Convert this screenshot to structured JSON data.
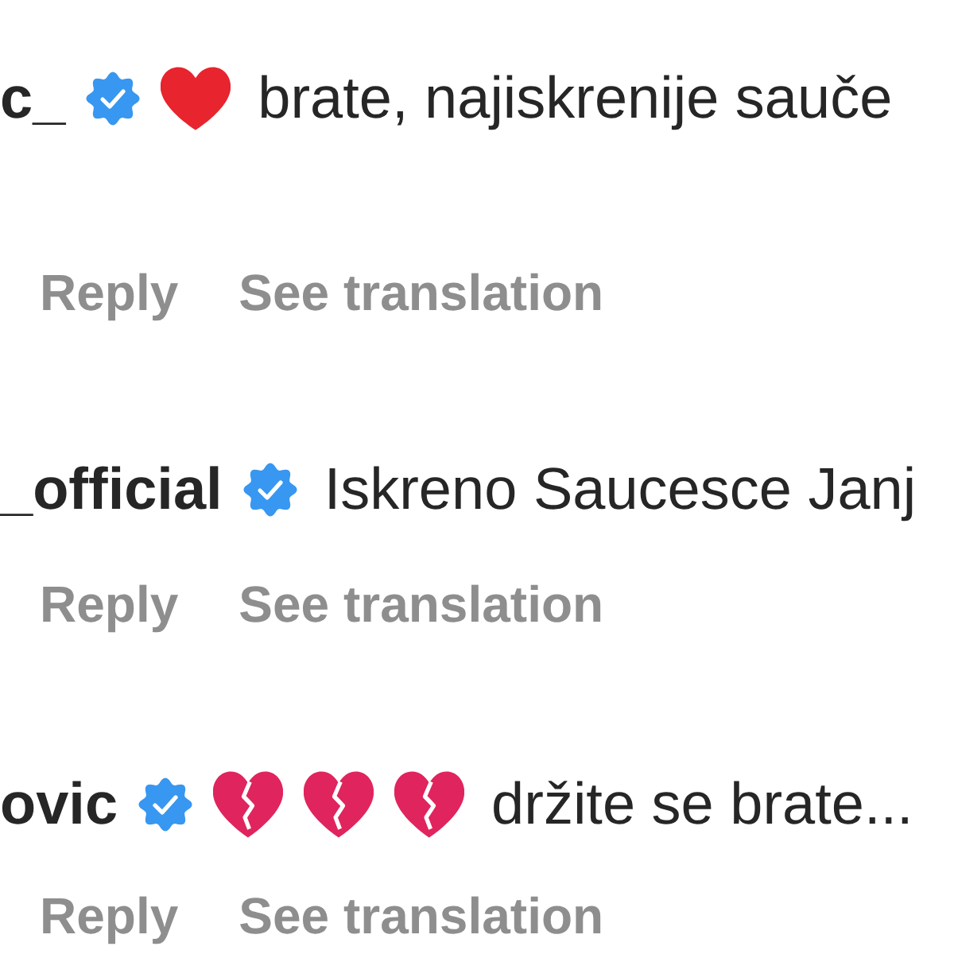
{
  "comments": [
    {
      "username": "c_",
      "verified": true,
      "emojis": [
        {
          "kind": "heart"
        }
      ],
      "text": "brate, najiskrenije sauče",
      "actions": [
        "Reply",
        "See translation"
      ]
    },
    {
      "username": "_official",
      "verified": true,
      "text": "Iskreno Saucesce Janj",
      "actions": [
        "Reply",
        "See translation"
      ]
    },
    {
      "username": "ovic",
      "verified": true,
      "emojis": [
        {
          "kind": "broken_heart"
        },
        {
          "kind": "broken_heart"
        },
        {
          "kind": "broken_heart"
        }
      ],
      "text": "držite se brate...",
      "actions": [
        "Reply",
        "See translation"
      ]
    }
  ]
}
